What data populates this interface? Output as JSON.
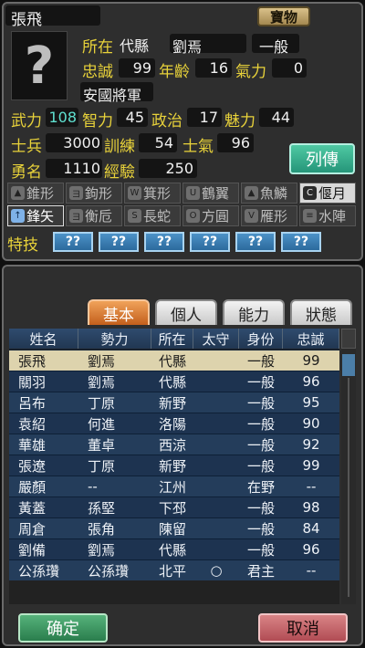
{
  "officer": {
    "name": "張飛",
    "treasure_label": "寶物",
    "portrait_glyph": "?",
    "location_label": "所在",
    "location": "代縣",
    "ruler": "劉焉",
    "status": "一般",
    "loyalty_label": "忠誠",
    "loyalty": "99",
    "age_label": "年齡",
    "age": "16",
    "energy_label": "氣力",
    "energy": "0",
    "title": "安國將軍",
    "war_label": "武力",
    "war": "108",
    "int_label": "智力",
    "int": "45",
    "pol_label": "政治",
    "pol": "17",
    "charm_label": "魅力",
    "charm": "44",
    "troops_label": "士兵",
    "troops": "3000",
    "training_label": "訓練",
    "training": "54",
    "morale_label": "士氣",
    "morale": "96",
    "fame_label": "勇名",
    "fame": "1110",
    "exp_label": "經驗",
    "exp": "250",
    "biography_label": "列傳",
    "skill_label": "特技",
    "skills": [
      "??",
      "??",
      "??",
      "??",
      "??",
      "??"
    ]
  },
  "formations": [
    {
      "icon": "▲",
      "label": "錐形",
      "state": "normal"
    },
    {
      "icon": "ヨ",
      "label": "鉤形",
      "state": "normal"
    },
    {
      "icon": "W",
      "label": "箕形",
      "state": "normal"
    },
    {
      "icon": "U",
      "label": "鶴翼",
      "state": "normal"
    },
    {
      "icon": "▲",
      "label": "魚鱗",
      "state": "normal"
    },
    {
      "icon": "C",
      "label": "偃月",
      "state": "active"
    },
    {
      "icon": "↑",
      "label": "鋒矢",
      "state": "selected"
    },
    {
      "icon": "ヨ",
      "label": "衡卮",
      "state": "normal"
    },
    {
      "icon": "S",
      "label": "長蛇",
      "state": "normal"
    },
    {
      "icon": "O",
      "label": "方圓",
      "state": "normal"
    },
    {
      "icon": "V",
      "label": "雁形",
      "state": "normal"
    },
    {
      "icon": "≡",
      "label": "水陣",
      "state": "normal"
    }
  ],
  "tabs": [
    "基本",
    "個人",
    "能力",
    "狀態"
  ],
  "active_tab": "基本",
  "table": {
    "headers": [
      "姓名",
      "勢力",
      "所在",
      "太守",
      "身份",
      "忠誠"
    ],
    "rows": [
      [
        "張飛",
        "劉焉",
        "代縣",
        "",
        "一般",
        "99"
      ],
      [
        "關羽",
        "劉焉",
        "代縣",
        "",
        "一般",
        "96"
      ],
      [
        "呂布",
        "丁原",
        "新野",
        "",
        "一般",
        "95"
      ],
      [
        "袁紹",
        "何進",
        "洛陽",
        "",
        "一般",
        "90"
      ],
      [
        "華雄",
        "董卓",
        "西涼",
        "",
        "一般",
        "92"
      ],
      [
        "張遼",
        "丁原",
        "新野",
        "",
        "一般",
        "99"
      ],
      [
        "嚴顏",
        "--",
        "江州",
        "",
        "在野",
        "--"
      ],
      [
        "黃蓋",
        "孫堅",
        "下邳",
        "",
        "一般",
        "98"
      ],
      [
        "周倉",
        "張角",
        "陳留",
        "",
        "一般",
        "84"
      ],
      [
        "劉備",
        "劉焉",
        "代縣",
        "",
        "一般",
        "96"
      ],
      [
        "公孫瓚",
        "公孫瓚",
        "北平",
        "○",
        "君主",
        "--"
      ]
    ]
  },
  "buttons": {
    "confirm": "确定",
    "cancel": "取消"
  },
  "colors": {
    "stat_label": "#e8d23a",
    "war_value": "#5fe0d0",
    "tab_active": "#d9793a",
    "row_selected": "#ddd3ad",
    "row_normal": "#243d5b"
  }
}
